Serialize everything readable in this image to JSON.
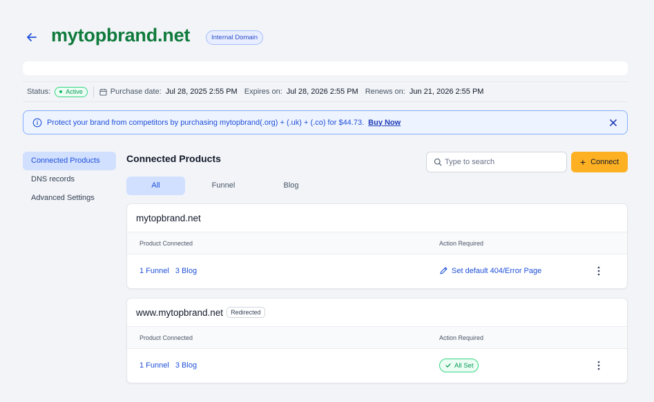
{
  "header": {
    "domain": "mytopbrand.net",
    "badge": "Internal Domain"
  },
  "status_row": {
    "status_label": "Status:",
    "status_value": "Active",
    "purchase_label": "Purchase date:",
    "purchase_value": "Jul 28, 2025 2:55 PM",
    "expires_label": "Expires on:",
    "expires_value": "Jul 28, 2026 2:55 PM",
    "renews_label": "Renews on:",
    "renews_value": "Jun 21, 2026 2:55 PM"
  },
  "banner": {
    "text": "Protect your brand from competitors by purchasing mytopbrand(.org) + (.uk) + (.co) for $44.73.",
    "cta": "Buy Now"
  },
  "sidebar": {
    "items": [
      {
        "label": "Connected Products"
      },
      {
        "label": "DNS records"
      },
      {
        "label": "Advanced Settings"
      }
    ]
  },
  "main": {
    "title": "Connected Products",
    "search_placeholder": "Type to search",
    "connect_label": "Connect",
    "tabs": [
      {
        "label": "All"
      },
      {
        "label": "Funnel"
      },
      {
        "label": "Blog"
      }
    ],
    "cards": [
      {
        "domain": "mytopbrand.net",
        "col_product": "Product Connected",
        "col_action": "Action Required",
        "funnel": "1 Funnel",
        "blog": "3 Blog",
        "action": "Set default 404/Error Page"
      },
      {
        "domain": "www.mytopbrand.net",
        "badge": "Redirected",
        "col_product": "Product Connected",
        "col_action": "Action Required",
        "funnel": "1 Funnel",
        "blog": "3 Blog",
        "action": "All Set"
      }
    ]
  },
  "colors": {
    "brand_green": "#0f7a3c",
    "accent_blue": "#1d4ed8",
    "connect_yellow": "#fdb022",
    "success_green": "#039855"
  }
}
